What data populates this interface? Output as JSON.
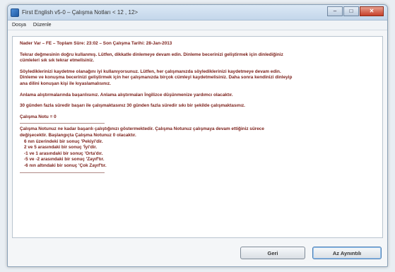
{
  "window": {
    "title": "First English v5-0  –  Çalışma Notları < 12 , 12>",
    "controls": {
      "minimize_icon": "minimize-icon",
      "maximize_icon": "maximize-icon",
      "close_icon": "close-icon"
    }
  },
  "menu": {
    "items": [
      "Dosya",
      "Düzenle"
    ]
  },
  "content": {
    "header": "Nader Var  –  FE  –  Toplam Süre: 23:02  –  Son Çalışma Tarihi: 28-Jan-2013",
    "paragraph1": [
      "Tekrar değmesinin doğru kullanmış. Lütfen, dikkatle dinlemeye devam edin. Dinleme becerinizi geliştirmek için dinlediğiniz",
      "cümleleri sık sık tekrar etmelisiniz."
    ],
    "paragraph2": [
      "Söylediklerinizi kaydetme olanağını iyi kullanıyorsunuz. Lütfen, her çalışmanızda söylediklerinizi kaydetmeye devam edin.",
      "Dinleme ve konuşma becerinizi geliştirmek için her çalışmanızda birçok cümleyi kaydetmelisiniz. Daha sonra kendinizi dinleyip",
      "ana dilini konuşan kişi ile kıyaslamalısınız."
    ],
    "paragraph3": "Anlama alıştırmalarında başarılısınız.  Anlama alıştırmaları İngilizce düşünmenize yardımcı olacaktır.",
    "paragraph4": "30 günden fazla süredir başarı ile çalışmaktasınız  30 günden fazla süredir sıkı bir şekilde çalışmaktasınız.",
    "study_note": "Çalışma Notu = 0",
    "paragraph5": [
      "Çalışma Notunuz ne kadar başarılı çalıştığınızı göstermektedir.  Çalışma Notunuz çalışmaya devam ettiğiniz sürece",
      "değişecektir.  Başlangıçta Çalışma Notunuz  0  olacaktır."
    ],
    "scale": [
      "6 nın üzerindeki bir sonuç 'Pekiyi'dir.",
      "2 ve 5 arasındaki bir sonuç 'İyi'dir.",
      "-1 ve 1 arasındaki bir sonuç 'Orta'dır.",
      "-5 ve -2 arasındaki bir sonuç 'Zayıf'tır.",
      "-6 nın altındaki bir sonuç 'Çok Zayıf'tır."
    ]
  },
  "buttons": {
    "back": "Geri",
    "next": "Az Aynıntılı"
  }
}
